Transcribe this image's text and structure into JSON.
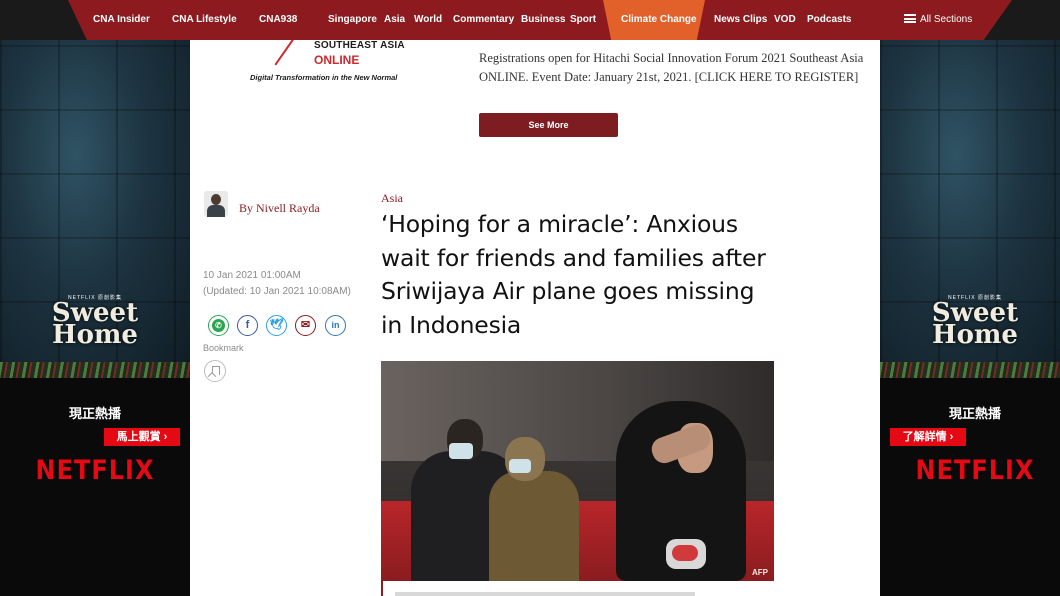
{
  "nav": {
    "items": [
      "CNA Insider",
      "CNA Lifestyle",
      "CNA938",
      "Singapore",
      "Asia",
      "World",
      "Commentary",
      "Business",
      "Sport",
      "Climate Change",
      "News Clips",
      "VOD",
      "Podcasts"
    ],
    "all_sections": "All Sections",
    "highlight_item": "Climate Change",
    "colors": {
      "bar": "#8c1a1f",
      "highlight": "#e2612a"
    }
  },
  "ads": {
    "netflix_small": "NETFLIX 原創影集",
    "show_title_line1": "Sweet",
    "show_title_line2": "Home",
    "now_streaming": "現正熱播",
    "left_cta": "馬上觀賞 ›",
    "right_cta": "了解詳情 ›",
    "brand": "NETFLIX"
  },
  "promo": {
    "logo_line1": "SOUTHEAST ASIA",
    "logo_line2": "ONLINE",
    "logo_tagline": "Digital Transformation in the New Normal",
    "text": "Registrations open for Hitachi Social Innovation Forum 2021 Southeast Asia ONLINE. Event Date: January 21st, 2021. [CLICK HERE TO REGISTER]",
    "button": "See More"
  },
  "article": {
    "author": "By Nivell Rayda",
    "date": "10 Jan 2021 01:00AM",
    "updated": "(Updated: 10 Jan 2021 10:08AM)",
    "bookmark_label": "Bookmark",
    "share_icons": [
      "whatsapp-icon",
      "facebook-icon",
      "twitter-icon",
      "email-icon",
      "linkedin-icon"
    ],
    "category": "Asia",
    "headline": "‘Hoping for a miracle’: Anxious wait for friends and families after Sriwijaya Air plane goes missing in Indonesia",
    "photo_credit": "AFP"
  }
}
